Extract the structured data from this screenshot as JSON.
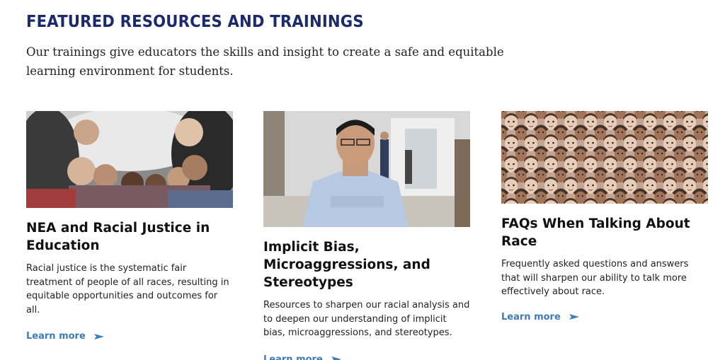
{
  "section": {
    "title": "FEATURED RESOURCES AND TRAININGS",
    "intro": "Our trainings give educators the skills and insight to create a safe and equitable learning environment for students."
  },
  "cards": [
    {
      "title": "NEA and Racial Justice in Education",
      "description": "Racial justice is the systematic fair treatment of people of all races, resulting in equitable opportunities and outcomes for all.",
      "link_label": "Learn more",
      "image": "group-of-students-looking-down-photo"
    },
    {
      "title": "Implicit Bias, Microaggressions, and Stereotypes",
      "description": "Resources to sharpen our racial analysis and to deepen our understanding of implicit bias, microaggressions, and stereotypes.",
      "link_label": "Learn more",
      "image": "man-with-crossed-arms-in-hallway-photo"
    },
    {
      "title": "FAQs When Talking About Race",
      "description": "Frequently asked questions and answers that will sharpen our ability to talk more effectively about race.",
      "link_label": "Learn more",
      "image": "illustrated-diverse-faces-pattern"
    }
  ],
  "colors": {
    "title": "#1b2a6b",
    "link": "#3d7cb8"
  }
}
